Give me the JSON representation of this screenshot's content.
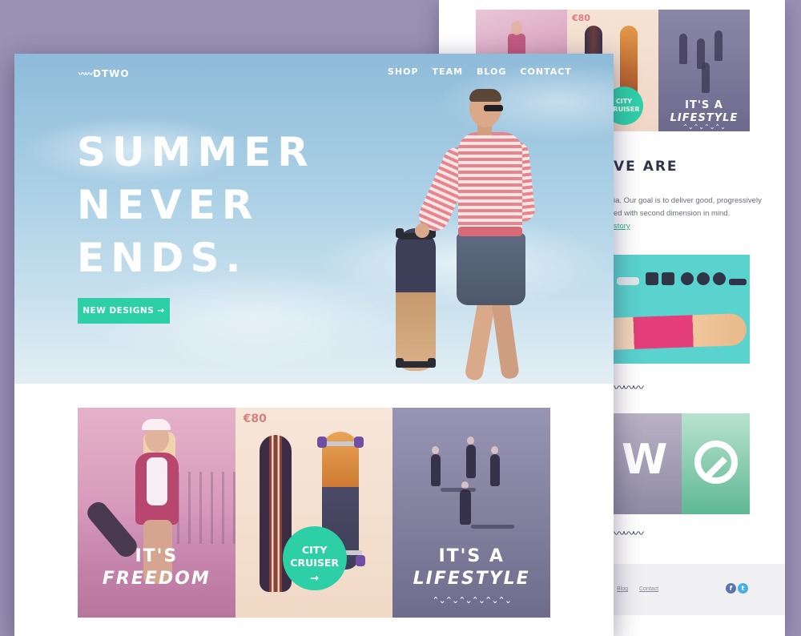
{
  "back_page": {
    "tiles": {
      "price": "€80",
      "city_cruiser_line1": "CITY",
      "city_cruiser_line2": "CRUISER",
      "lifestyle_line1": "IT'S A",
      "lifestyle_line2": "LIFESTYLE",
      "zigzag": "⌃⌄⌃⌄⌃⌄⌃⌄"
    },
    "about": {
      "heading": "VE ARE",
      "text_line1": "ia. Our goal is to deliver good, progressively",
      "text_line2": "ed with second dimension in mind.",
      "link": "story"
    },
    "squiggle": "〰〰〰",
    "footer": {
      "links": [
        "Blog",
        "Contact"
      ],
      "social": [
        "f",
        "t"
      ]
    }
  },
  "front_page": {
    "logo": "DTWO",
    "logo_wave": "〰〰",
    "nav": [
      "SHOP",
      "TEAM",
      "BLOG",
      "CONTACT"
    ],
    "hero": {
      "title_lines": [
        "SUMMER",
        "NEVER",
        "ENDS."
      ],
      "cta_label": "NEW DESIGNS →"
    },
    "tiles": {
      "freedom_line1": "IT'S",
      "freedom_line2": "FREEDOM",
      "price": "€80",
      "city_line1": "CITY",
      "city_line2": "CRUISER",
      "city_arrow": "→",
      "lifestyle_line1": "IT'S A",
      "lifestyle_line2": "LIFESTYLE",
      "zigzag": "⌃⌄⌃⌄⌃⌄⌃⌄⌃⌄⌃⌄"
    }
  },
  "colors": {
    "accent": "#2ccfa6",
    "background": "#9a92b4",
    "price": "#d87f80",
    "heading_dark": "#2f3446"
  }
}
